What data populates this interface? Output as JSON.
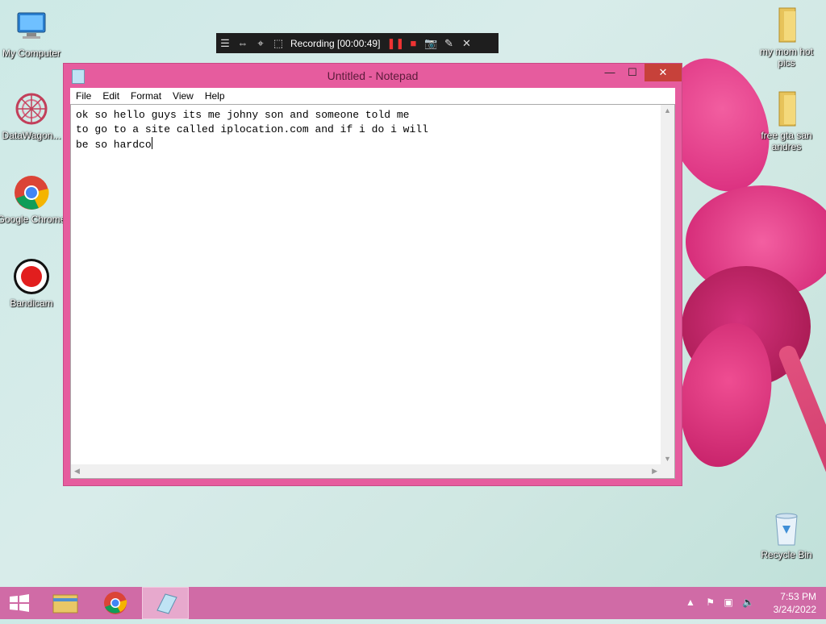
{
  "desktop": {
    "icons_left": [
      {
        "label": "My Computer",
        "icon": "computer-icon"
      },
      {
        "label": "DataWagon...",
        "icon": "datawagon-icon"
      },
      {
        "label": "Google Chrome",
        "icon": "chrome-icon"
      },
      {
        "label": "Bandicam",
        "icon": "bandicam-icon"
      }
    ],
    "icons_right": [
      {
        "label": "my mom hot pics",
        "icon": "folder-icon"
      },
      {
        "label": "free gta san andres",
        "icon": "folder-icon"
      },
      {
        "label": "Recycle Bin",
        "icon": "recycle-bin-icon"
      }
    ]
  },
  "recorder": {
    "label": "Recording [00:00:49]",
    "icons": [
      "menu-icon",
      "resize-icon",
      "target-icon",
      "region-icon",
      "pause-icon",
      "stop-icon",
      "camera-icon",
      "pencil-icon",
      "close-icon"
    ]
  },
  "notepad": {
    "title": "Untitled - Notepad",
    "controls": {
      "minimize": "—",
      "maximize": "☐",
      "close": "✕"
    },
    "menu": [
      "File",
      "Edit",
      "Format",
      "View",
      "Help"
    ],
    "lines": [
      "ok so hello guys its me johny son and someone told me",
      "to go to a site called iplocation.com and if i do i will",
      "be so hardco"
    ]
  },
  "taskbar": {
    "apps": [
      "file-explorer-icon",
      "chrome-icon",
      "notepad-icon"
    ],
    "clock": {
      "time": "7:53 PM",
      "date": "3/24/2022"
    }
  },
  "colors": {
    "window_frame": "#e65c9e",
    "taskbar": "#d06ba6",
    "close_button": "#c7413a",
    "recorder_bar": "#1e1e1e"
  }
}
